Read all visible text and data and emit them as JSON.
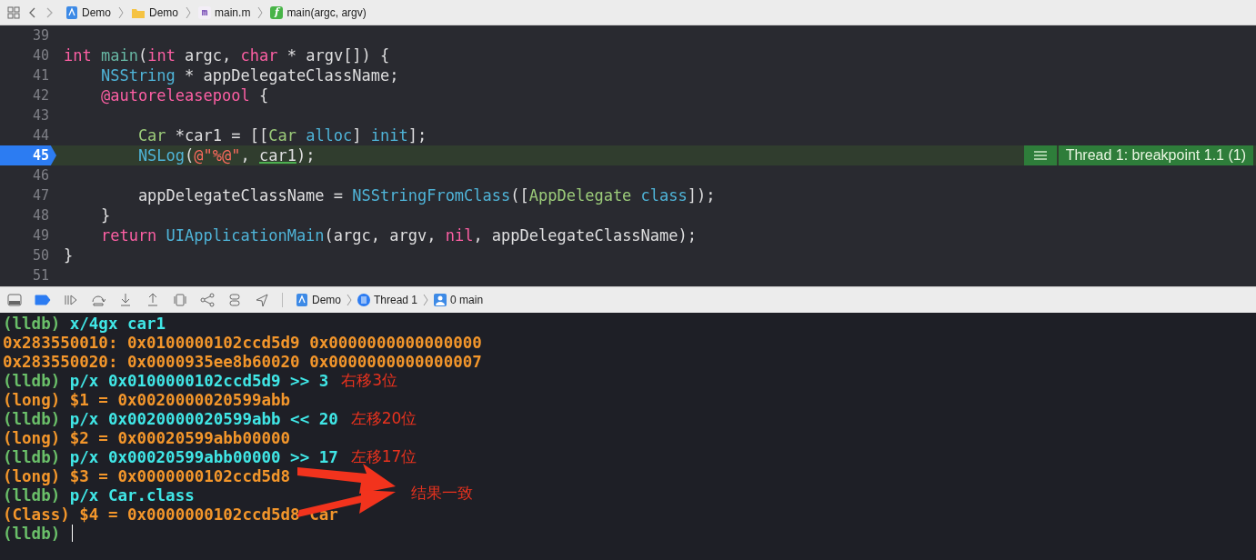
{
  "jump_bar": [
    {
      "label": "Demo",
      "kind": "project"
    },
    {
      "label": "Demo",
      "kind": "folder"
    },
    {
      "label": "main.m",
      "kind": "file",
      "glyph": "m"
    },
    {
      "label": "main(argc, argv)",
      "kind": "function",
      "glyph": "f"
    }
  ],
  "editor": {
    "lines": [
      {
        "number": "39",
        "current": false
      },
      {
        "number": "40",
        "current": false,
        "tokens": [
          {
            "text": "int ",
            "kind": "kw"
          },
          {
            "text": "main",
            "kind": "func"
          },
          {
            "text": "(",
            "kind": "plain"
          },
          {
            "text": "int",
            "kind": "kw"
          },
          {
            "text": " argc, ",
            "kind": "plain"
          },
          {
            "text": "char",
            "kind": "kw"
          },
          {
            "text": " * argv[]) {",
            "kind": "plain"
          }
        ]
      },
      {
        "number": "41",
        "current": false,
        "tokens": [
          {
            "text": "    NSString",
            "kind": "sysclass"
          },
          {
            "text": " * appDelegateClassName;",
            "kind": "plain"
          }
        ]
      },
      {
        "number": "42",
        "current": false,
        "tokens": [
          {
            "text": "    @autoreleasepool",
            "kind": "kw"
          },
          {
            "text": " {",
            "kind": "plain"
          }
        ]
      },
      {
        "number": "43",
        "current": false
      },
      {
        "number": "44",
        "current": false,
        "tokens": [
          {
            "text": "        Car",
            "kind": "projclass"
          },
          {
            "text": " *car1 = [[",
            "kind": "plain"
          },
          {
            "text": "Car",
            "kind": "projclass"
          },
          {
            "text": " alloc",
            "kind": "sysmethod"
          },
          {
            "text": "] ",
            "kind": "plain"
          },
          {
            "text": "init",
            "kind": "sysmethod"
          },
          {
            "text": "];",
            "kind": "plain"
          }
        ]
      },
      {
        "number": "45",
        "current": true,
        "tokens": [
          {
            "text": "        NSLog",
            "kind": "sysmethod"
          },
          {
            "text": "(",
            "kind": "plain"
          },
          {
            "text": "@\"%@\"",
            "kind": "string"
          },
          {
            "text": ", ",
            "kind": "plain"
          },
          {
            "text": "car1",
            "kind": "underlined"
          },
          {
            "text": ");",
            "kind": "plain"
          }
        ],
        "annotation": "Thread 1: breakpoint 1.1 (1)"
      },
      {
        "number": "46",
        "current": false
      },
      {
        "number": "47",
        "current": false,
        "tokens": [
          {
            "text": "        appDelegateClassName = ",
            "kind": "plain"
          },
          {
            "text": "NSStringFromClass",
            "kind": "sysmethod"
          },
          {
            "text": "([",
            "kind": "plain"
          },
          {
            "text": "AppDelegate",
            "kind": "projclass"
          },
          {
            "text": " class",
            "kind": "sysmethod"
          },
          {
            "text": "]);",
            "kind": "plain"
          }
        ]
      },
      {
        "number": "48",
        "current": false,
        "tokens": [
          {
            "text": "    }",
            "kind": "plain"
          }
        ]
      },
      {
        "number": "49",
        "current": false,
        "tokens": [
          {
            "text": "    return",
            "kind": "kw"
          },
          {
            "text": " UIApplicationMain",
            "kind": "sysmethod"
          },
          {
            "text": "(argc, argv, ",
            "kind": "plain"
          },
          {
            "text": "nil",
            "kind": "kw"
          },
          {
            "text": ", appDelegateClassName);",
            "kind": "plain"
          }
        ]
      },
      {
        "number": "50",
        "current": false,
        "tokens": [
          {
            "text": "}",
            "kind": "plain"
          }
        ]
      },
      {
        "number": "51",
        "current": false
      }
    ]
  },
  "debug_bar": {
    "breakpoints_active": true,
    "path": [
      {
        "label": "Demo",
        "kind": "app"
      },
      {
        "label": "Thread 1",
        "kind": "thread"
      },
      {
        "label": "0 main",
        "kind": "frame"
      }
    ]
  },
  "console": {
    "lines": [
      {
        "parts": [
          {
            "text": "(lldb) ",
            "kind": "prompt"
          },
          {
            "text": "x/4gx car1",
            "kind": "command"
          }
        ]
      },
      {
        "parts": [
          {
            "text": "0x283550010: 0x0100000102ccd5d9 0x0000000000000000",
            "kind": "output"
          }
        ]
      },
      {
        "parts": [
          {
            "text": "0x283550020: 0x0000935ee8b60020 0x0000000000000007",
            "kind": "output"
          }
        ]
      },
      {
        "parts": [
          {
            "text": "(lldb) ",
            "kind": "prompt"
          },
          {
            "text": "p/x 0x0100000102ccd5d9 >> 3",
            "kind": "command"
          }
        ],
        "note": "右移3位"
      },
      {
        "parts": [
          {
            "text": "(long) $1 = 0x0020000020599abb",
            "kind": "output"
          }
        ]
      },
      {
        "parts": [
          {
            "text": "(lldb) ",
            "kind": "prompt"
          },
          {
            "text": "p/x 0x0020000020599abb << 20",
            "kind": "command"
          }
        ],
        "note": "左移20位"
      },
      {
        "parts": [
          {
            "text": "(long) $2 = 0x00020599abb00000",
            "kind": "output"
          }
        ]
      },
      {
        "parts": [
          {
            "text": "(lldb) ",
            "kind": "prompt"
          },
          {
            "text": "p/x 0x00020599abb00000 >> 17",
            "kind": "command"
          }
        ],
        "note": "左移17位"
      },
      {
        "parts": [
          {
            "text": "(long) $3 = 0x0000000102ccd5d8",
            "kind": "output"
          }
        ]
      },
      {
        "parts": [
          {
            "text": "(lldb) ",
            "kind": "prompt"
          },
          {
            "text": "p/x Car.class",
            "kind": "command"
          }
        ]
      },
      {
        "parts": [
          {
            "text": "(Class) $4 = 0x0000000102ccd5d8 Car",
            "kind": "output"
          }
        ]
      },
      {
        "parts": [
          {
            "text": "(lldb)",
            "kind": "prompt"
          }
        ],
        "cursor": true
      }
    ],
    "callout": "结果一致"
  }
}
